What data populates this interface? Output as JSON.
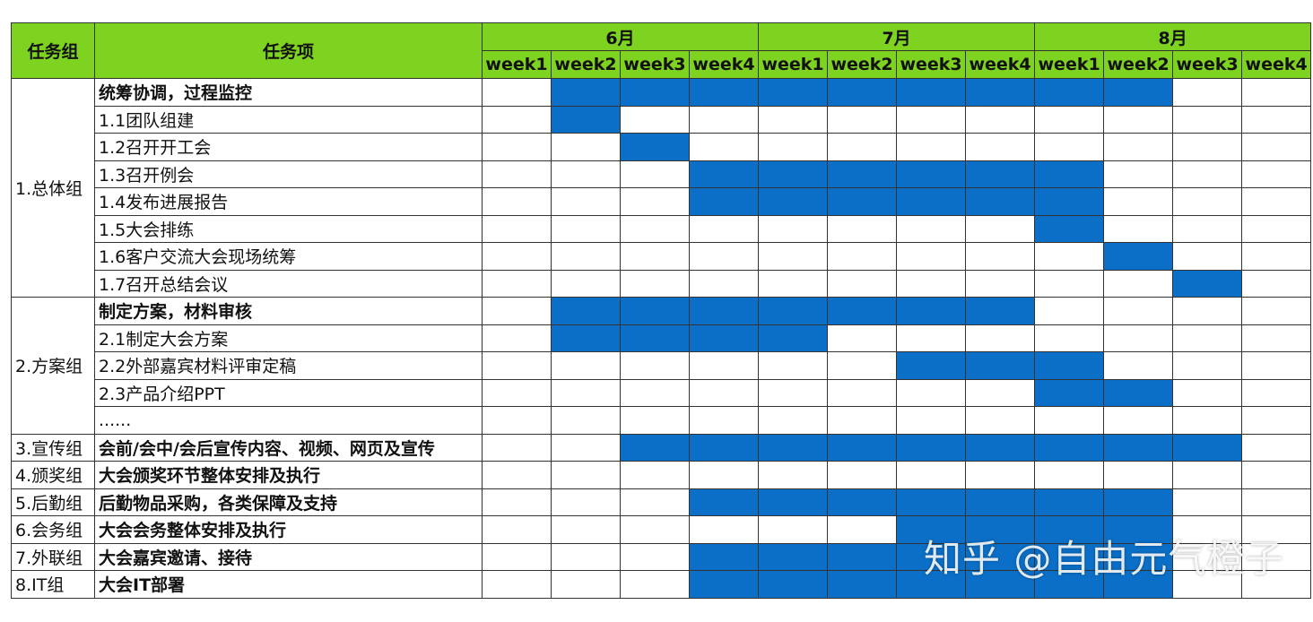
{
  "headers": {
    "group": "任务组",
    "task": "任务项",
    "months": [
      "6月",
      "7月",
      "8月"
    ],
    "weeks": [
      "week1",
      "week2",
      "week3",
      "week4",
      "week1",
      "week2",
      "week3",
      "week4",
      "week1",
      "week2",
      "week3",
      "week4"
    ]
  },
  "bar_color": "#0b6fc7",
  "header_color": "#7ed321",
  "groups": [
    {
      "name": "1.总体组",
      "rows": [
        {
          "task": "统筹协调，过程监控",
          "bold": true,
          "weeks": [
            0,
            1,
            1,
            1,
            1,
            1,
            1,
            1,
            1,
            1,
            0,
            0
          ]
        },
        {
          "task": "1.1团队组建",
          "bold": false,
          "weeks": [
            0,
            1,
            0,
            0,
            0,
            0,
            0,
            0,
            0,
            0,
            0,
            0
          ]
        },
        {
          "task": "1.2召开开工会",
          "bold": false,
          "weeks": [
            0,
            0,
            1,
            0,
            0,
            0,
            0,
            0,
            0,
            0,
            0,
            0
          ]
        },
        {
          "task": "1.3召开例会",
          "bold": false,
          "weeks": [
            0,
            0,
            0,
            1,
            1,
            1,
            1,
            1,
            1,
            0,
            0,
            0
          ]
        },
        {
          "task": "1.4发布进展报告",
          "bold": false,
          "weeks": [
            0,
            0,
            0,
            1,
            1,
            1,
            1,
            1,
            1,
            0,
            0,
            0
          ]
        },
        {
          "task": "1.5大会排练",
          "bold": false,
          "weeks": [
            0,
            0,
            0,
            0,
            0,
            0,
            0,
            0,
            1,
            0,
            0,
            0
          ]
        },
        {
          "task": "1.6客户交流大会现场统筹",
          "bold": false,
          "weeks": [
            0,
            0,
            0,
            0,
            0,
            0,
            0,
            0,
            0,
            1,
            0,
            0
          ]
        },
        {
          "task": "1.7召开总结会议",
          "bold": false,
          "weeks": [
            0,
            0,
            0,
            0,
            0,
            0,
            0,
            0,
            0,
            0,
            1,
            0
          ]
        }
      ]
    },
    {
      "name": "2.方案组",
      "rows": [
        {
          "task": "制定方案，材料审核",
          "bold": true,
          "weeks": [
            0,
            1,
            1,
            1,
            1,
            1,
            1,
            1,
            0,
            0,
            0,
            0
          ]
        },
        {
          "task": "2.1制定大会方案",
          "bold": false,
          "weeks": [
            0,
            1,
            1,
            1,
            1,
            0,
            0,
            0,
            0,
            0,
            0,
            0
          ]
        },
        {
          "task": "2.2外部嘉宾材料评审定稿",
          "bold": false,
          "weeks": [
            0,
            0,
            0,
            0,
            0,
            0,
            1,
            1,
            1,
            0,
            0,
            0
          ]
        },
        {
          "task": "2.3产品介绍PPT",
          "bold": false,
          "weeks": [
            0,
            0,
            0,
            0,
            0,
            0,
            0,
            0,
            1,
            1,
            0,
            0
          ]
        },
        {
          "task": "......",
          "bold": false,
          "weeks": [
            0,
            0,
            0,
            0,
            0,
            0,
            0,
            0,
            0,
            0,
            0,
            0
          ]
        }
      ]
    },
    {
      "name": "3.宣传组",
      "rows": [
        {
          "task": "会前/会中/会后宣传内容、视频、网页及宣传",
          "bold": true,
          "weeks": [
            0,
            0,
            1,
            1,
            1,
            1,
            1,
            1,
            1,
            1,
            1,
            0
          ]
        }
      ]
    },
    {
      "name": "4.颁奖组",
      "rows": [
        {
          "task": "大会颁奖环节整体安排及执行",
          "bold": true,
          "weeks": [
            0,
            0,
            0,
            0,
            0,
            0,
            0,
            0,
            0,
            0,
            0,
            0
          ]
        }
      ]
    },
    {
      "name": "5.后勤组",
      "rows": [
        {
          "task": "后勤物品采购，各类保障及支持",
          "bold": true,
          "weeks": [
            0,
            0,
            0,
            1,
            1,
            1,
            1,
            1,
            1,
            1,
            0,
            0
          ]
        }
      ]
    },
    {
      "name": "6.会务组",
      "rows": [
        {
          "task": "大会会务整体安排及执行",
          "bold": true,
          "weeks": [
            0,
            0,
            0,
            0,
            0,
            0,
            1,
            1,
            1,
            1,
            0,
            0
          ]
        }
      ]
    },
    {
      "name": "7.外联组",
      "rows": [
        {
          "task": "大会嘉宾邀请、接待",
          "bold": true,
          "weeks": [
            0,
            0,
            0,
            1,
            1,
            1,
            1,
            1,
            1,
            1,
            0,
            0
          ]
        }
      ]
    },
    {
      "name": "8.IT组",
      "rows": [
        {
          "task": "大会IT部署",
          "bold": true,
          "weeks": [
            0,
            0,
            0,
            1,
            1,
            1,
            1,
            1,
            1,
            1,
            0,
            0
          ]
        }
      ]
    }
  ],
  "watermark": "知乎 @自由元气橙子"
}
